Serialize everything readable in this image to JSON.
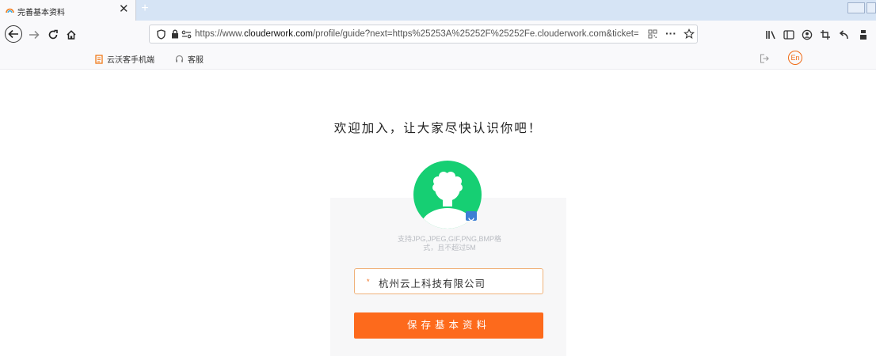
{
  "browser": {
    "tab": {
      "title": "完善基本资料",
      "close_label": "✕",
      "new_tab_label": "+"
    },
    "address_bar": {
      "url_prefix": "https://www.",
      "url_domain": "clouderwork.com",
      "url_rest": "/profile/guide?next=https%25253A%25252F%25252Fe.clouderwork.com&ticket=",
      "page_actions_label": "···"
    },
    "bookmarks": [
      {
        "label": "云沃客手机端",
        "icon": "document-icon"
      },
      {
        "label": "客服",
        "icon": "headset-icon"
      }
    ],
    "language_badge": "En",
    "colors": {
      "tabstrip": "#d6e4f5",
      "accent_orange": "#fd6a1c",
      "avatar_green": "#16cf73"
    }
  },
  "page": {
    "welcome_title": "欢迎加入，让大家尽快认识你吧！",
    "upload_hint_line1": "支持JPG,JPEG,GIF,PNG,BMP格",
    "upload_hint_line2": "式，且不超过5M",
    "company_field": {
      "required_mark": "*",
      "value": "杭州云上科技有限公司"
    },
    "save_button_label": "保存基本资料"
  }
}
